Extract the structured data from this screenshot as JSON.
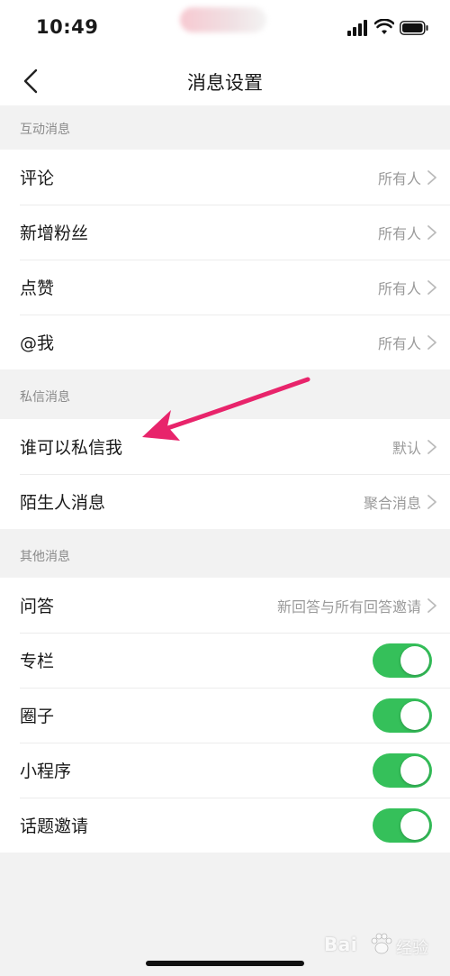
{
  "status_bar": {
    "time": "10:49"
  },
  "nav": {
    "title": "消息设置"
  },
  "sections": [
    {
      "header": "互动消息",
      "rows": [
        {
          "label": "评论",
          "value": "所有人"
        },
        {
          "label": "新增粉丝",
          "value": "所有人"
        },
        {
          "label": "点赞",
          "value": "所有人"
        },
        {
          "label": "@我",
          "value": "所有人"
        }
      ]
    },
    {
      "header": "私信消息",
      "rows": [
        {
          "label": "谁可以私信我",
          "value": "默认"
        },
        {
          "label": "陌生人消息",
          "value": "聚合消息"
        }
      ]
    },
    {
      "header": "其他消息",
      "rows": [
        {
          "label": "问答",
          "value": "新回答与所有回答邀请"
        },
        {
          "label": "专栏",
          "toggle": true
        },
        {
          "label": "圈子",
          "toggle": true
        },
        {
          "label": "小程序",
          "toggle": true
        },
        {
          "label": "话题邀请",
          "toggle": true
        }
      ]
    }
  ],
  "watermark": {
    "brand": "Bai",
    "suffix": "经验"
  },
  "colors": {
    "toggle_on": "#35c05a",
    "annotation_arrow": "#e8246b",
    "section_bg": "#f2f2f2"
  }
}
